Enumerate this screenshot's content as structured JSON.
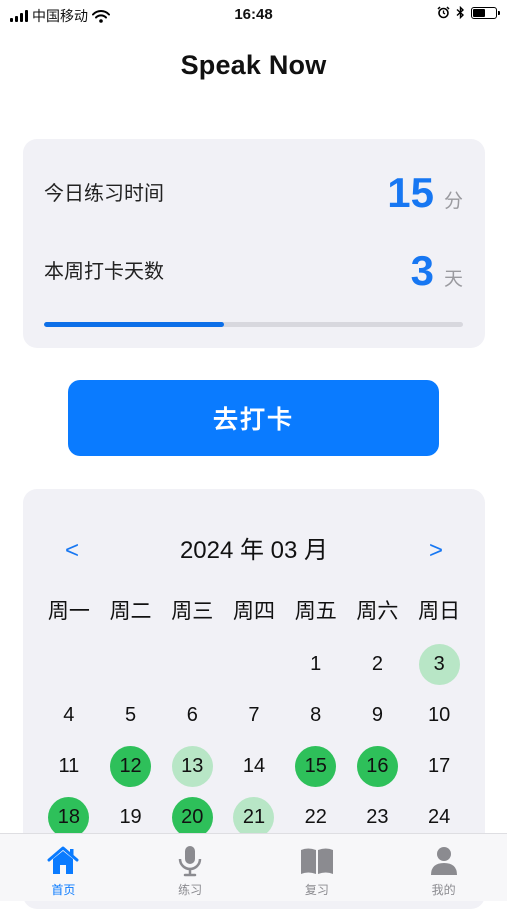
{
  "status_bar": {
    "carrier": "中国移动",
    "time": "16:48",
    "battery_level": 0.6
  },
  "app_title": "Speak Now",
  "stats": {
    "practice_label": "今日练习时间",
    "practice_value": "15",
    "practice_unit": "分",
    "checkin_label": "本周打卡天数",
    "checkin_value": "3",
    "checkin_unit": "天",
    "progress": 0.43
  },
  "checkin_button": "去打卡",
  "calendar": {
    "prev": "<",
    "next": ">",
    "month_label": "2024 年 03 月",
    "weekdays": [
      "周一",
      "周二",
      "周三",
      "周四",
      "周五",
      "周六",
      "周日"
    ],
    "leading_blanks": 4,
    "days": [
      {
        "d": "1",
        "s": ""
      },
      {
        "d": "2",
        "s": ""
      },
      {
        "d": "3",
        "s": "light"
      },
      {
        "d": "4",
        "s": ""
      },
      {
        "d": "5",
        "s": ""
      },
      {
        "d": "6",
        "s": ""
      },
      {
        "d": "7",
        "s": ""
      },
      {
        "d": "8",
        "s": ""
      },
      {
        "d": "9",
        "s": ""
      },
      {
        "d": "10",
        "s": ""
      },
      {
        "d": "11",
        "s": ""
      },
      {
        "d": "12",
        "s": "strong"
      },
      {
        "d": "13",
        "s": "light"
      },
      {
        "d": "14",
        "s": ""
      },
      {
        "d": "15",
        "s": "strong"
      },
      {
        "d": "16",
        "s": "strong"
      },
      {
        "d": "17",
        "s": ""
      },
      {
        "d": "18",
        "s": "strong"
      },
      {
        "d": "19",
        "s": ""
      },
      {
        "d": "20",
        "s": "strong"
      },
      {
        "d": "21",
        "s": "light"
      },
      {
        "d": "22",
        "s": ""
      },
      {
        "d": "23",
        "s": ""
      },
      {
        "d": "24",
        "s": ""
      }
    ],
    "colors": {
      "strong": "#2ec05a",
      "light": "#b8e6c6"
    }
  },
  "tabbar": {
    "tabs": [
      {
        "label": "首页",
        "icon": "home-icon",
        "active": true
      },
      {
        "label": "练习",
        "icon": "microphone-icon",
        "active": false
      },
      {
        "label": "复习",
        "icon": "book-icon",
        "active": false
      },
      {
        "label": "我的",
        "icon": "person-icon",
        "active": false
      }
    ],
    "active_color": "#0a7bff",
    "inactive_color": "#8b8b90"
  }
}
